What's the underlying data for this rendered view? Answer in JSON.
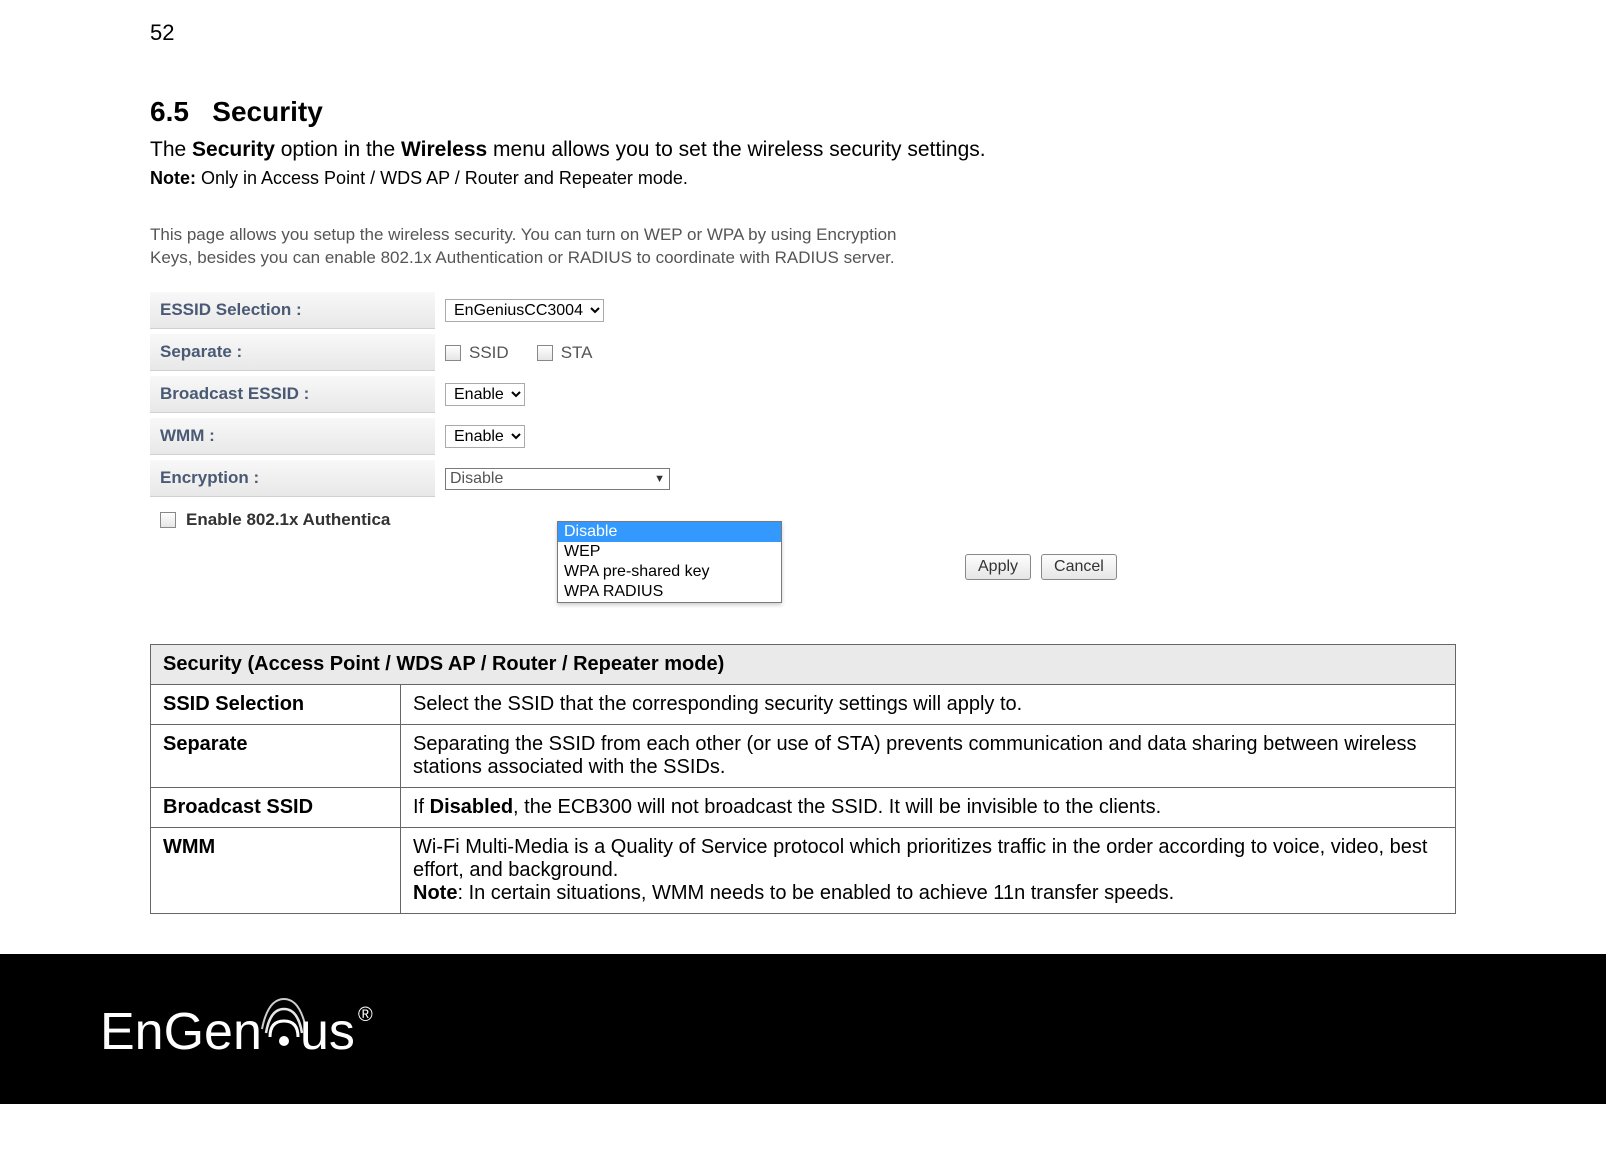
{
  "page_number": "52",
  "section": {
    "number": "6.5",
    "title": "Security",
    "intro_pre": "The ",
    "intro_b1": "Security",
    "intro_mid": " option in the ",
    "intro_b2": "Wireless",
    "intro_post": " menu allows you to set the wireless security settings.",
    "note_label": "Note:",
    "note_text": " Only in Access Point / WDS AP / Router and Repeater mode."
  },
  "panel": {
    "description": "This page allows you setup the wireless security. You can turn on WEP or WPA by using Encryption Keys, besides you can enable 802.1x Authentication or RADIUS to coordinate with RADIUS server.",
    "rows": {
      "essid_label": "ESSID Selection :",
      "essid_value": "EnGeniusCC3004",
      "separate_label": "Separate :",
      "separate_opt1": "SSID",
      "separate_opt2": "STA",
      "broadcast_label": "Broadcast ESSID :",
      "broadcast_value": "Enable",
      "wmm_label": "WMM :",
      "wmm_value": "Enable",
      "encryption_label": "Encryption :",
      "encryption_value": "Disable",
      "auth_label": "Enable 802.1x Authentica"
    },
    "dropdown": {
      "opt1": "Disable",
      "opt2": "WEP",
      "opt3": "WPA pre-shared key",
      "opt4": "WPA RADIUS"
    },
    "buttons": {
      "apply": "Apply",
      "cancel": "Cancel"
    }
  },
  "desc_table": {
    "header": "Security (Access Point / WDS AP / Router / Repeater mode)",
    "rows": [
      {
        "label": "SSID Selection",
        "text": "Select the SSID that the corresponding security settings will apply to."
      },
      {
        "label": "Separate",
        "text": "Separating the SSID from each other (or use of STA) prevents communication and data sharing between wireless stations associated with the SSIDs."
      },
      {
        "label": "Broadcast SSID",
        "text_pre": "If ",
        "text_b": "Disabled",
        "text_post": ", the ECB300 will not broadcast the SSID. It will be invisible to the clients."
      },
      {
        "label": "WMM",
        "text": "Wi-Fi Multi-Media is a Quality of Service protocol which prioritizes traffic in the order according to voice, video, best effort, and background.",
        "note_label": "Note",
        "note_text": ": In certain situations, WMM needs to be enabled to achieve 11n transfer speeds."
      }
    ]
  },
  "footer": {
    "brand": "EnGenius"
  }
}
